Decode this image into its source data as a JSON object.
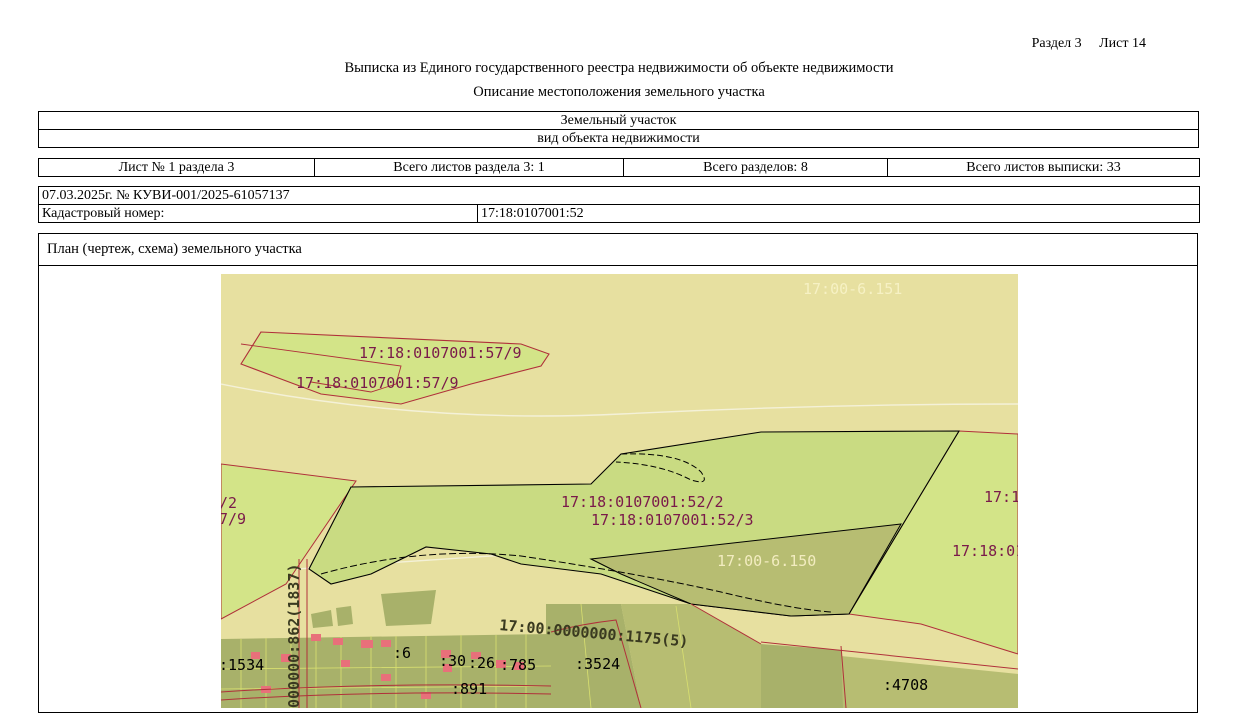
{
  "header": {
    "section": "Раздел 3",
    "sheet": "Лист 14",
    "title": "Выписка из Единого государственного реестра недвижимости об объекте недвижимости",
    "subtitle": "Описание местоположения земельного участка"
  },
  "object": {
    "type": "Земельный участок",
    "type_caption": "вид объекта недвижимости"
  },
  "counters": {
    "sheet_of_section": "Лист № 1 раздела 3",
    "total_sheets_section": "Всего листов раздела 3: 1",
    "total_sections": "Всего разделов: 8",
    "total_sheets_extract": "Всего листов выписки: 33"
  },
  "record": {
    "date_number": "07.03.2025г. № КУВИ-001/2025-61057137",
    "cadastral_label": "Кадастровый номер:",
    "cadastral_value": "17:18:0107001:52"
  },
  "plan": {
    "title": "План (чертеж, схема) земельного участка",
    "labels": {
      "zone_top": "17:00-6.151",
      "parcel_57_9_a": "17:18:0107001:57/9",
      "parcel_57_9_b": "17:18:0107001:57/9",
      "left_2": "/2",
      "left_7_9": "7/9",
      "parcel_52_2": "17:18:0107001:52/2",
      "parcel_52_3": "17:18:0107001:52/3",
      "zone_150": "17:00-6.150",
      "right_a": "17:1",
      "right_b": "17:18:01",
      "vertical": "000000:862(1837)",
      "road": "17:00:0000000:1175(5)",
      "q1534": ":1534",
      "q6": ":6",
      "q30": ":30",
      "q26": ":26",
      "q785": ":785",
      "q3524": ":3524",
      "q891": ":891",
      "q4708": ":4708"
    },
    "colors": {
      "background": "#e7e0a0",
      "light_green": "#d3e488",
      "parcel_green": "#c9db82",
      "dark_green": "#b7bd72",
      "quarter_green": "#a8b16a",
      "building_red": "#e8707a",
      "boundary_red": "#b0303a",
      "label_maroon": "#7a1a4a"
    }
  }
}
